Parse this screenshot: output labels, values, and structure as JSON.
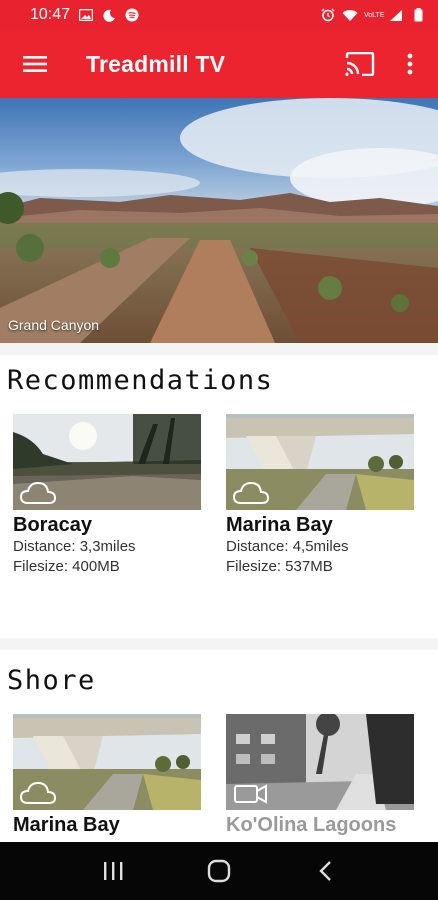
{
  "status_bar": {
    "time": "10:47",
    "left_icons": [
      "image-icon",
      "moon-icon",
      "spotify-icon"
    ],
    "right_icons": [
      "alarm-icon",
      "wifi-icon",
      "signal-icon",
      "battery-icon"
    ],
    "network_label": "VoLTE"
  },
  "app_bar": {
    "title": "Treadmill TV",
    "menu_icon": "hamburger-menu-icon",
    "cast_icon": "cast-icon",
    "more_icon": "more-vertical-icon"
  },
  "hero": {
    "caption": "Grand Canyon"
  },
  "sections": [
    {
      "title": "Recommendations",
      "cards": [
        {
          "title": "Boracay",
          "distance": "Distance: 3,3miles",
          "filesize": "Filesize: 400MB"
        },
        {
          "title": "Marina Bay",
          "distance": "Distance: 4,5miles",
          "filesize": "Filesize: 537MB"
        }
      ]
    },
    {
      "title": "Shore",
      "cards": [
        {
          "title": "Marina Bay"
        },
        {
          "title": "Ko'Olina Lagoons"
        }
      ]
    }
  ],
  "nav_bar": {
    "buttons": [
      "recent-apps-icon",
      "home-icon",
      "back-icon"
    ]
  },
  "colors": {
    "primary": "#ec2430",
    "status_bar": "#e8232f",
    "nav_bar": "#060606"
  }
}
